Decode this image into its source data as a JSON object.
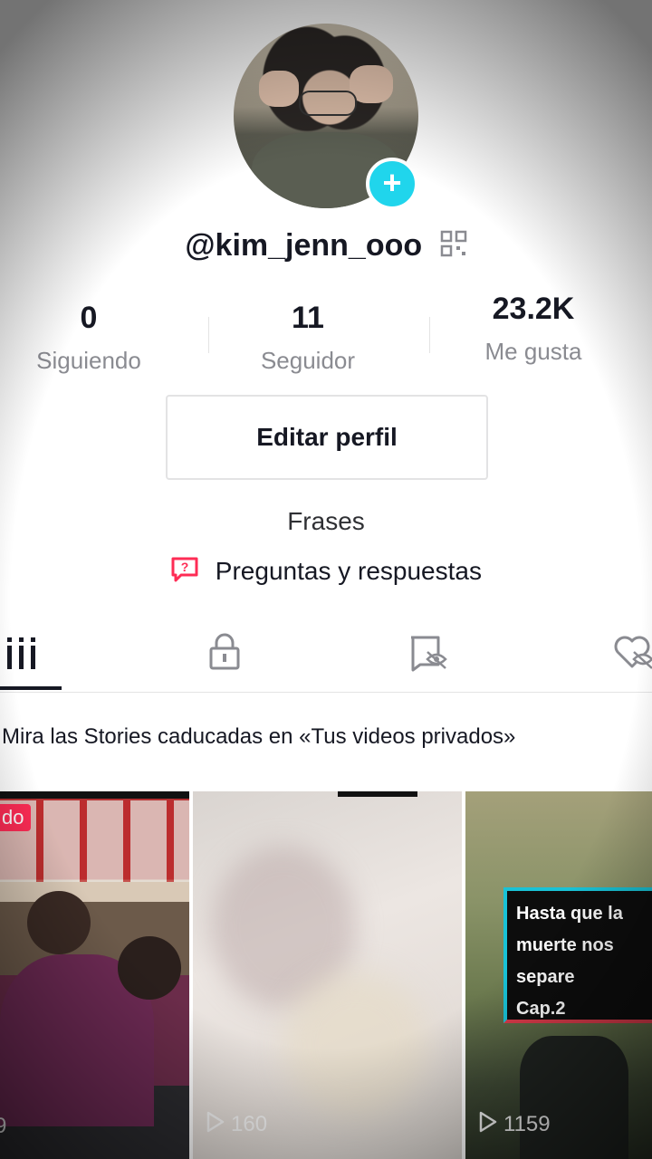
{
  "profile": {
    "username": "@kim_jenn_ooo",
    "stats": [
      {
        "value": "0",
        "label": "Siguiendo"
      },
      {
        "value": "11",
        "label": "Seguidor"
      },
      {
        "value": "23.2K",
        "label": "Me gusta"
      }
    ],
    "edit_button": "Editar perfil",
    "bio": "Frases",
    "qa_link": "Preguntas y respuestas"
  },
  "tabs": [
    {
      "icon": "grid-icon",
      "active": true
    },
    {
      "icon": "lock-icon",
      "active": false
    },
    {
      "icon": "tagged-hidden-icon",
      "active": false
    },
    {
      "icon": "liked-hidden-icon",
      "active": false
    }
  ],
  "notice": "Mira las Stories caducadas en «Tus videos privados»",
  "videos": [
    {
      "tag": "do",
      "views": "9"
    },
    {
      "views": "160"
    },
    {
      "caption_lines": [
        "Hasta que la",
        "muerte nos",
        "separe",
        "Cap.2"
      ],
      "views": "1159"
    }
  ],
  "colors": {
    "accent": "#20d5ec",
    "tag": "#fe2c55",
    "text": "#161823",
    "muted": "#8a8b91"
  }
}
